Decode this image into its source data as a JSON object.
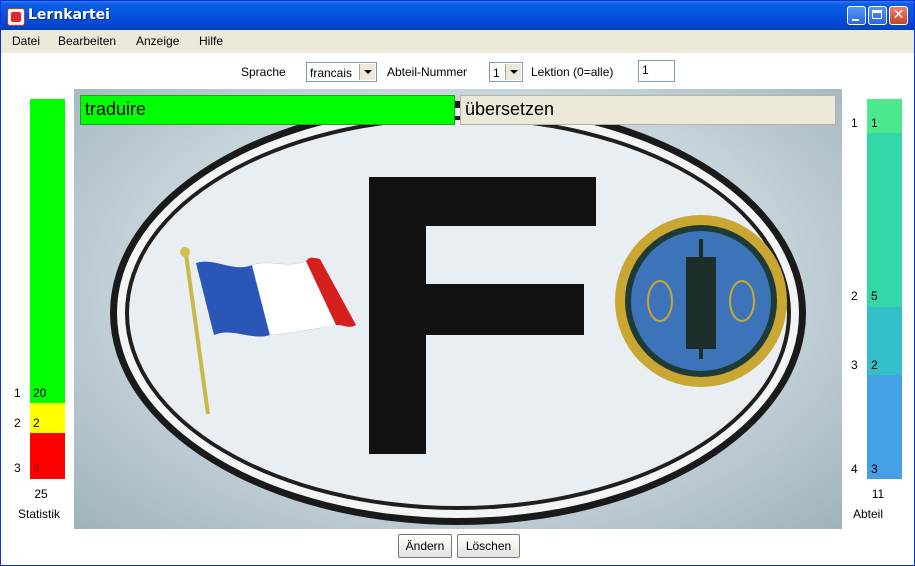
{
  "window": {
    "title": "Lernkartei"
  },
  "menu": [
    "Datei",
    "Bearbeiten",
    "Anzeige",
    "Hilfe"
  ],
  "toolbar": {
    "sprache_label": "Sprache",
    "sprache_value": "francais",
    "abteil_label": "Abteil-Nummer",
    "abteil_value": "1",
    "lektion_label": "Lektion (0=alle)",
    "lektion_value": "1"
  },
  "card": {
    "question": "traduire",
    "answer": "übersetzen",
    "image": "french-oval-F-sticker",
    "sticker_letter": "F"
  },
  "statistik": {
    "caption": "Statistik",
    "total": "25",
    "rows": [
      {
        "num": "1",
        "count": "20",
        "color": "#00ff00"
      },
      {
        "num": "2",
        "count": "2",
        "color": "#ffff00"
      },
      {
        "num": "3",
        "count": "3",
        "color": "#ff0000"
      }
    ]
  },
  "abteil": {
    "caption": "Abteil",
    "total": "11",
    "rows": [
      {
        "num": "1",
        "count": "1",
        "color": "#4de88d"
      },
      {
        "num": "2",
        "count": "5",
        "color": "#33d6a6"
      },
      {
        "num": "3",
        "count": "2",
        "color": "#33bfc8"
      },
      {
        "num": "4",
        "count": "3",
        "color": "#44a0e4"
      }
    ]
  },
  "buttons": {
    "change": "Ändern",
    "delete": "Löschen"
  }
}
